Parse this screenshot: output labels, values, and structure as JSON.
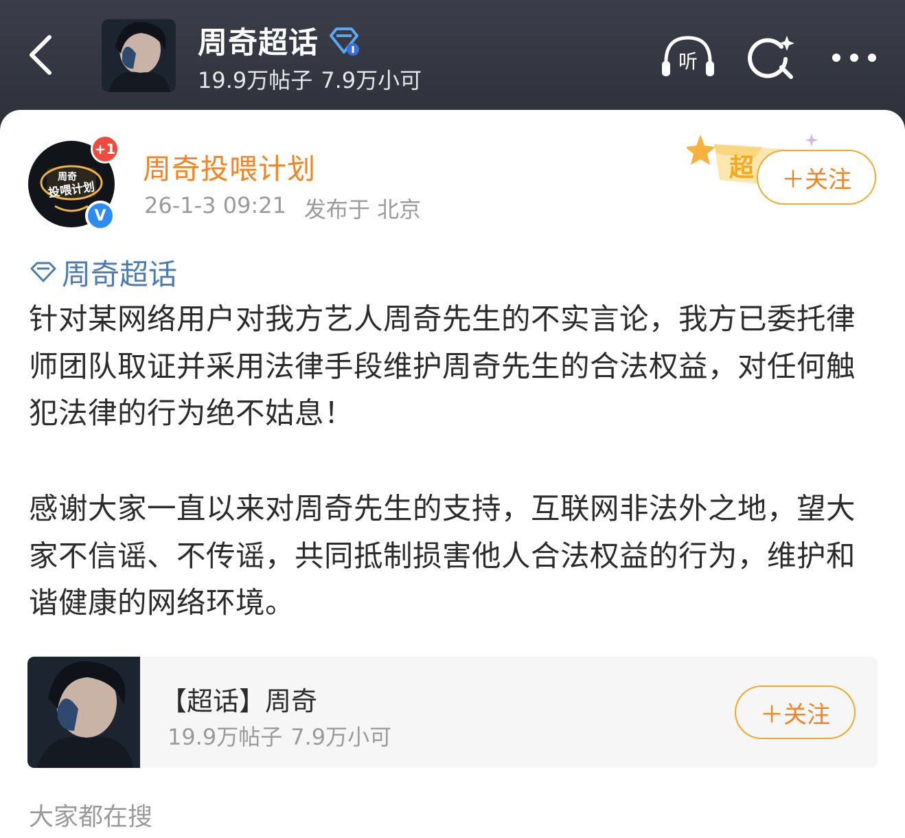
{
  "header": {
    "title": "周奇超话",
    "posts": "19.9万帖子",
    "members": "7.9万小可",
    "listen_label": "听"
  },
  "post": {
    "author": "周奇投喂计划",
    "avatar_text_line1": "周奇",
    "avatar_text_line2": "投喂计划",
    "avatar_badge": "+1",
    "verified_mark": "V",
    "time": "26-1-3 09:21",
    "location": "发布于 北京",
    "sticker_label": "超",
    "follow_label": "＋关注",
    "topic_tag": "周奇超话",
    "paragraph1": "针对某网络用户对我方艺人周奇先生的不实言论，我方已委托律师团队取证并采用法律手段维护周奇先生的合法权益，对任何触犯法律的行为绝不姑息！",
    "paragraph2": "感谢大家一直以来对周奇先生的支持，互联网非法外之地，望大家不信谣、不传谣，共同抵制损害他人合法权益的行为，维护和谐健康的网络环境。"
  },
  "topic_card": {
    "title": "【超话】周奇",
    "posts": "19.9万帖子",
    "members": "7.9万小可",
    "follow_label": "＋关注"
  },
  "footer": {
    "search_hint": "大家都在搜"
  },
  "colors": {
    "header_bg": "#2d3039",
    "accent_orange": "#f5821f",
    "link_blue": "#4b7bb0"
  },
  "icons": [
    "back-arrow-icon",
    "diamond-icon",
    "listen-headphone-icon",
    "search-sparkle-icon",
    "more-dots-icon"
  ]
}
